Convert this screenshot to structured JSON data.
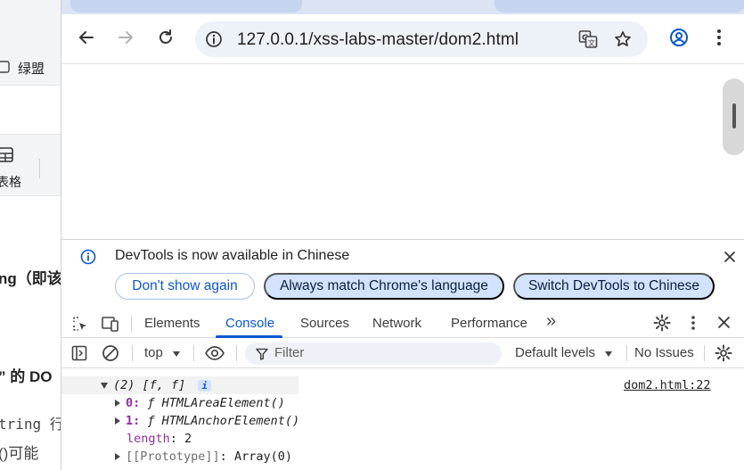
{
  "background_doc": {
    "bookmark_label": "绿盟",
    "table_label": "表格",
    "line1": "ng（即该",
    "line2": "” 的 DO",
    "line3": "tring 行",
    "line4": "()可能"
  },
  "browser": {
    "url": "127.0.0.1/xss-labs-master/dom2.html"
  },
  "devtools": {
    "infobar": {
      "message": "DevTools is now available in Chinese",
      "btn_dont_show": "Don't show again",
      "btn_always_match": "Always match Chrome's language",
      "btn_switch": "Switch DevTools to Chinese"
    },
    "tabs": {
      "elements": "Elements",
      "console": "Console",
      "sources": "Sources",
      "network": "Network",
      "performance": "Performance",
      "more": "»"
    },
    "console_toolbar": {
      "context": "top",
      "filter_placeholder": "Filter",
      "levels": "Default levels",
      "issues": "No Issues"
    },
    "output": {
      "array_summary": "(2) [f, f]",
      "info_badge": "i",
      "source_link": "dom2.html:22",
      "item0_index": "0:",
      "item0_value": "ƒ HTMLAreaElement()",
      "item1_index": "1:",
      "item1_value": "ƒ HTMLAnchorElement()",
      "length_key": "length",
      "length_value": "2",
      "prototype_key": "[[Prototype]]",
      "prototype_value": "Array(0)"
    }
  },
  "colors": {
    "accent": "#0b57d0",
    "tabstrip": "#dbe4f3",
    "omnibox": "#edf1f8",
    "pill_fill": "#d3e3fd"
  }
}
